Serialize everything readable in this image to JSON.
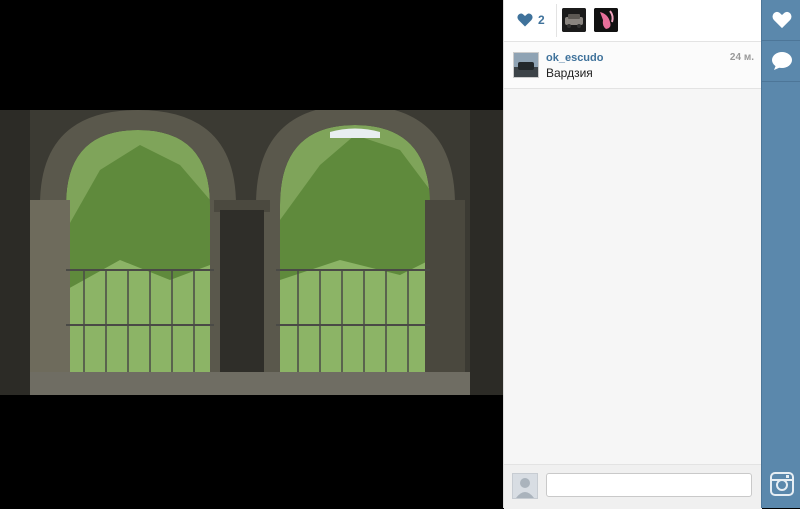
{
  "post": {
    "like_count": "2",
    "likers": [
      {
        "icon": "liker-avatar-car"
      },
      {
        "icon": "liker-avatar-flower"
      }
    ],
    "comment": {
      "username": "ok_escudo",
      "time": "24 м.",
      "text": "Вардзия"
    }
  },
  "composer": {
    "placeholder": ""
  },
  "colors": {
    "link_blue": "#3f729b",
    "rail_blue": "#5b88ac"
  }
}
